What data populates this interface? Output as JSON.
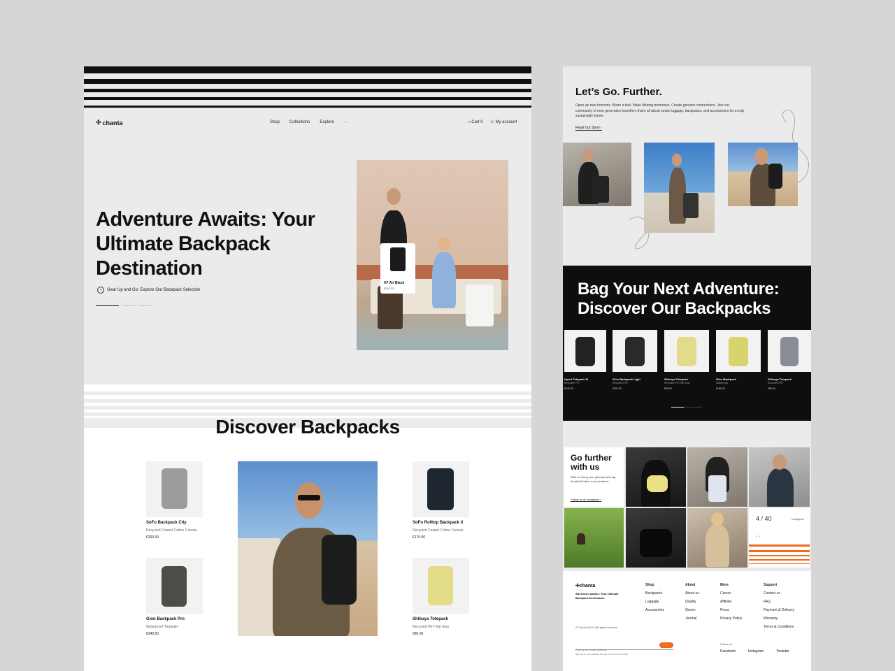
{
  "brand": {
    "name": "chanta"
  },
  "nav": {
    "items": [
      "Shop",
      "Collections",
      "Explore",
      "···"
    ],
    "cart": "Cart 0",
    "account": "My account"
  },
  "hero": {
    "title": [
      "Adventure Awaits: Your",
      "Ultimate Backpack",
      "Destination"
    ],
    "cta": "Gear Up and Go: Explore Our Backpack Selection",
    "product_card": {
      "name": "H7 Air Black",
      "price": "€340.00"
    }
  },
  "discover": {
    "title": "Discover Backpacks",
    "products": [
      {
        "name": "SoFo Backpack City",
        "material": "Recycled Coated Cotton Canvas",
        "price": "€260.00"
      },
      {
        "name": "SoFo Rolltop Backpack X",
        "material": "Recycled Coated Cotton Canvas",
        "price": "€170.00"
      },
      {
        "name": "Gion Backpack Pro",
        "material": "Waterproof Tarpaulin",
        "price": "€240.00"
      },
      {
        "name": "Shibuya Totepack",
        "material": "Recycled PET Rip Stop",
        "price": "€80.00"
      }
    ]
  },
  "further": {
    "title": "Let’s Go. Further.",
    "body": "Open up new horizons. Blaze a trail. Make lifelong memories. Create genuine connections. Join our community of next generation travellers that’s all about smart luggage, backpacks, and accessories for a truly sustainable future.",
    "link": "Read Our Story"
  },
  "bag_adventure": {
    "title": [
      "Bag Your Next Adventure:",
      "Discover Our Backpacks"
    ],
    "products": [
      {
        "name": "Uyuni Totepack M",
        "material": "Recycled PET",
        "price": "€240.00"
      },
      {
        "name": "Gion Backpack Light",
        "material": "Recycled PET",
        "price": "€200.00"
      },
      {
        "name": "Shibuya Totepack",
        "material": "Recycled PET Rip Stop",
        "price": "€80.00"
      },
      {
        "name": "Gion Backpack",
        "material": "Waterproof",
        "price": "€180.00"
      },
      {
        "name": "Shibuya Totepack",
        "material": "Recycled PET",
        "price": "€80.00"
      }
    ]
  },
  "social": {
    "title": [
      "Go further",
      "with us"
    ],
    "body": "Take us along your journeys and tag #LetsGoFurther to be featured.",
    "link": "Follow us on Instagram",
    "counter": "4 / 40",
    "counter_label": "Instagram"
  },
  "footer": {
    "tagline": "Adventure Awaits: Your Ultimate Backpack Destination",
    "copyright": "©Chanta 2024. All rights reserved.",
    "email_placeholder": "Enter your email address",
    "newsletter_note": "Sign up for our newsletter and get 10% of your first order",
    "cols": [
      {
        "head": "Shop",
        "items": [
          "Backpacks",
          "Luggage",
          "Accessories"
        ]
      },
      {
        "head": "About",
        "items": [
          "About us",
          "Quality",
          "Stores",
          "Journal"
        ]
      },
      {
        "head": "More",
        "items": [
          "Career",
          "Affiliate",
          "Press",
          "Privacy Policy"
        ]
      },
      {
        "head": "Support",
        "items": [
          "Contact us",
          "FAQ",
          "Payment & Delivery",
          "Warranty",
          "Terms & Conditions"
        ]
      }
    ],
    "follow": "Follow us",
    "socials": [
      "Facebook",
      "Instagram",
      "Youtube"
    ]
  },
  "colors": {
    "accent": "#f26a1b",
    "dark": "#0e0e0e",
    "panel": "#ebebeb"
  }
}
